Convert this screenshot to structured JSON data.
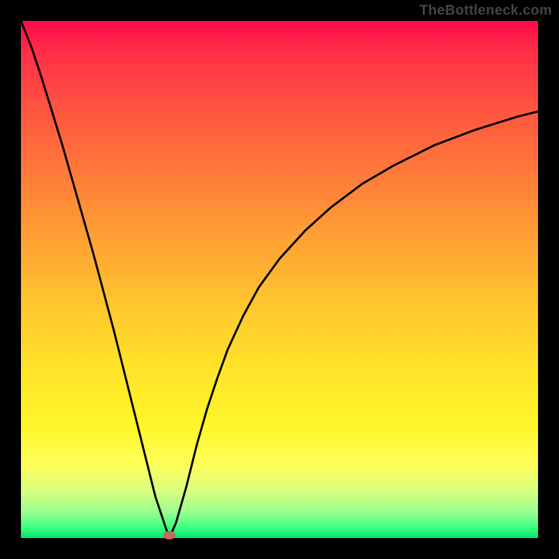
{
  "watermark": "TheBottleneck.com",
  "colors": {
    "background": "#000000",
    "curve": "#000000",
    "marker": "#c56a5f"
  },
  "chart_data": {
    "type": "line",
    "title": "",
    "xlabel": "",
    "ylabel": "",
    "xlim": [
      0,
      100
    ],
    "ylim": [
      0,
      100
    ],
    "grid": false,
    "legend": false,
    "series": [
      {
        "name": "left-branch",
        "x": [
          0,
          2,
          4,
          6,
          8,
          10,
          12,
          14,
          16,
          18,
          20,
          22,
          24,
          26,
          28,
          28.7
        ],
        "y": [
          100,
          95,
          89,
          82.5,
          76,
          69,
          62,
          55,
          47.5,
          40,
          32,
          24,
          16,
          8,
          2,
          0
        ]
      },
      {
        "name": "right-branch",
        "x": [
          28.7,
          30,
          32,
          34,
          36,
          38,
          40,
          43,
          46,
          50,
          55,
          60,
          66,
          72,
          80,
          88,
          96,
          100
        ],
        "y": [
          0,
          3,
          10,
          18,
          25,
          31,
          36.5,
          43,
          48.5,
          54,
          59.5,
          64,
          68.5,
          72,
          76,
          79,
          81.5,
          82.5
        ]
      }
    ],
    "annotations": [
      {
        "name": "minimum-marker",
        "x": 28.7,
        "y": 0
      }
    ]
  }
}
